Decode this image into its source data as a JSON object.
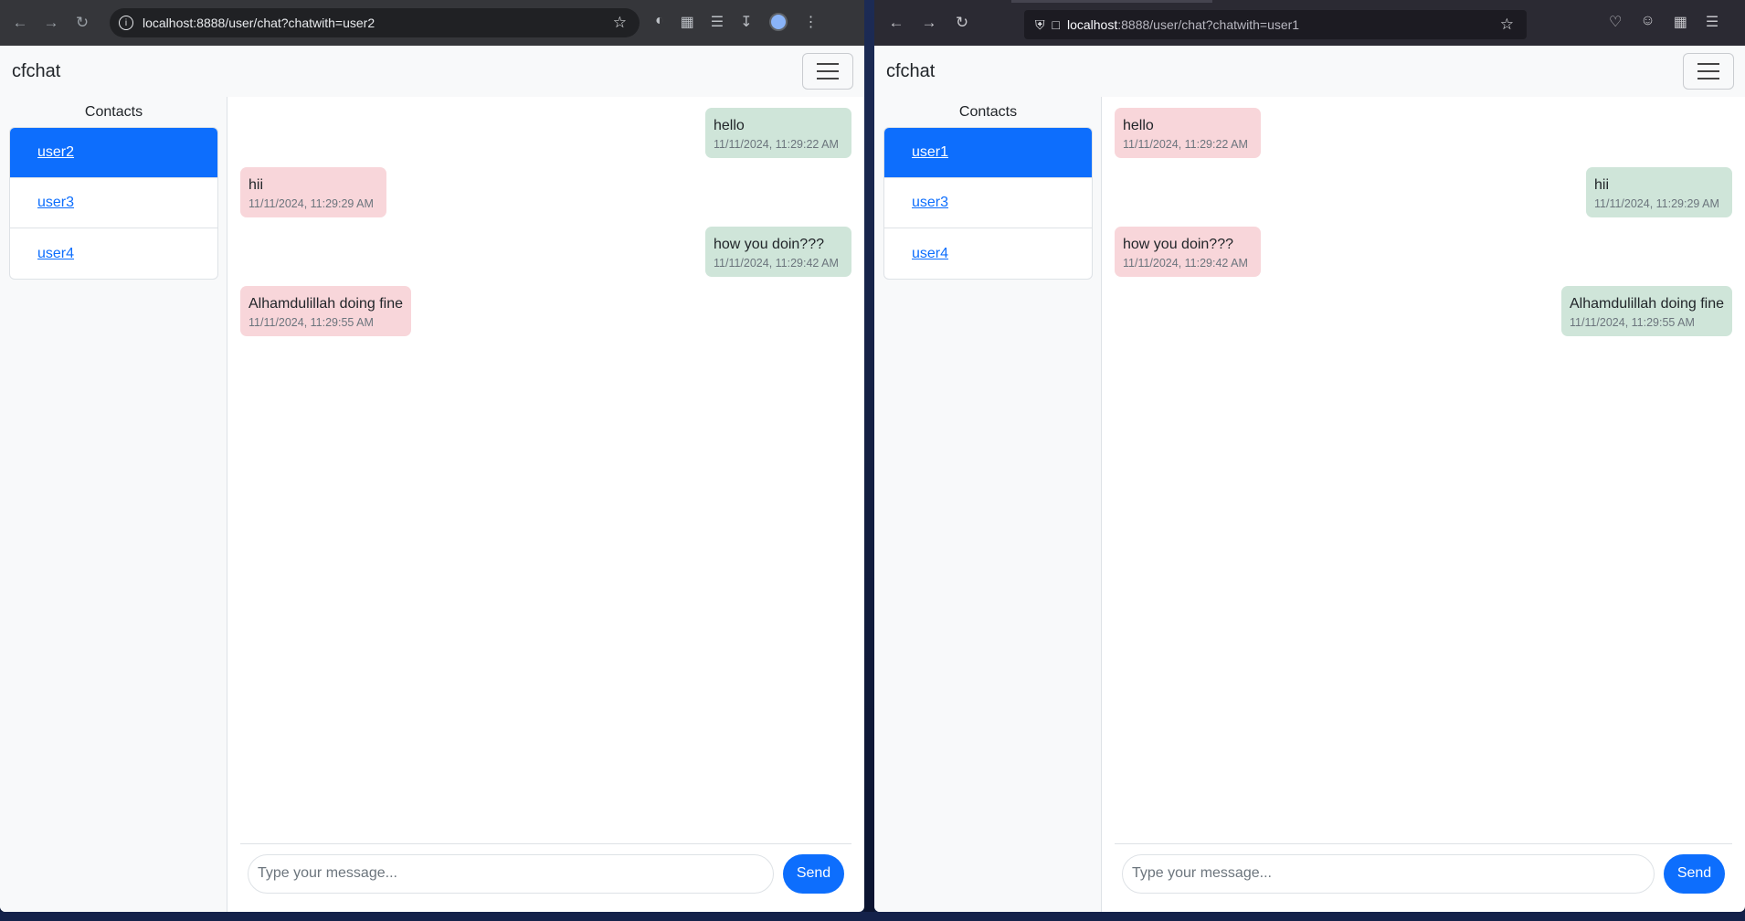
{
  "left": {
    "url_host": "localhost",
    "url_rest": ":8888/user/chat?chatwith=user2",
    "brand": "cfchat",
    "contacts_title": "Contacts",
    "contacts": [
      {
        "label": "user2",
        "active": true
      },
      {
        "label": "user3",
        "active": false
      },
      {
        "label": "user4",
        "active": false
      }
    ],
    "messages": [
      {
        "text": "hello",
        "time": "11/11/2024, 11:29:22 AM",
        "dir": "sent"
      },
      {
        "text": "hii",
        "time": "11/11/2024, 11:29:29 AM",
        "dir": "recv"
      },
      {
        "text": "how you doin???",
        "time": "11/11/2024, 11:29:42 AM",
        "dir": "sent"
      },
      {
        "text": "Alhamdulillah doing fine",
        "time": "11/11/2024, 11:29:55 AM",
        "dir": "recv"
      }
    ],
    "placeholder": "Type your message...",
    "send_label": "Send"
  },
  "right": {
    "url_host": "localhost",
    "url_rest": ":8888/user/chat?chatwith=user1",
    "brand": "cfchat",
    "contacts_title": "Contacts",
    "contacts": [
      {
        "label": "user1",
        "active": true
      },
      {
        "label": "user3",
        "active": false
      },
      {
        "label": "user4",
        "active": false
      }
    ],
    "messages": [
      {
        "text": "hello",
        "time": "11/11/2024, 11:29:22 AM",
        "dir": "recv"
      },
      {
        "text": "hii",
        "time": "11/11/2024, 11:29:29 AM",
        "dir": "sent"
      },
      {
        "text": "how you doin???",
        "time": "11/11/2024, 11:29:42 AM",
        "dir": "recv"
      },
      {
        "text": "Alhamdulillah doing fine",
        "time": "11/11/2024, 11:29:55 AM",
        "dir": "sent"
      }
    ],
    "placeholder": "Type your message...",
    "send_label": "Send"
  },
  "colors": {
    "primary": "#0d6efd",
    "sent_bubble": "#cfe5d9",
    "received_bubble": "#f8d6da"
  }
}
